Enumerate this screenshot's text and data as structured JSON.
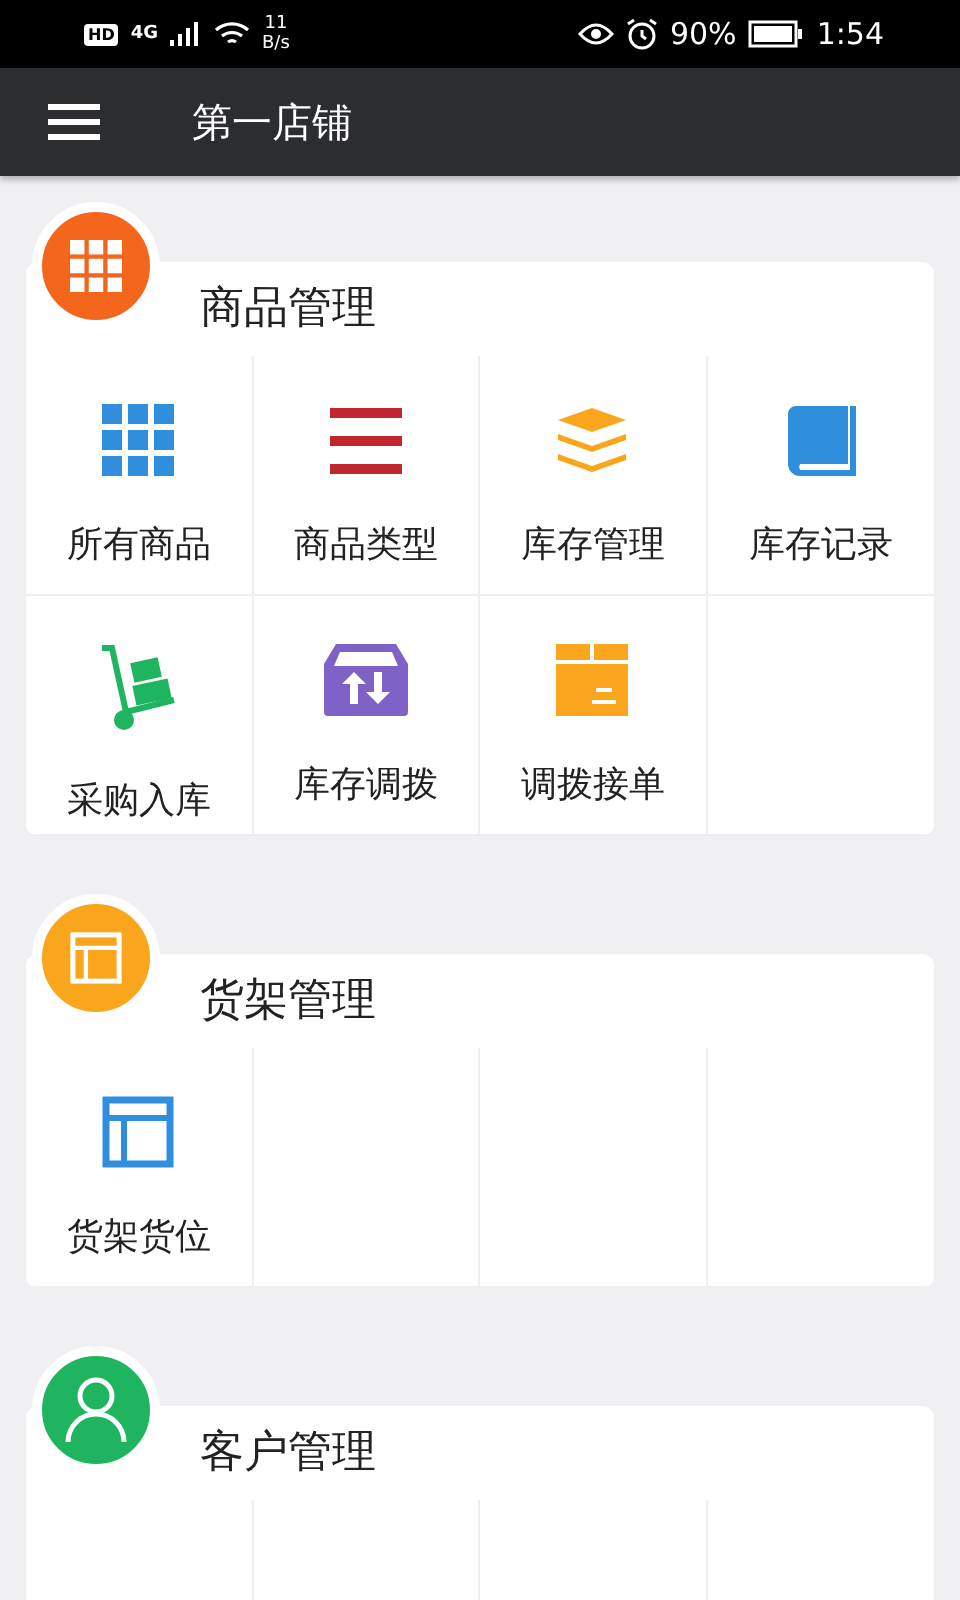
{
  "status_bar": {
    "hd": "HD",
    "network": "4G",
    "speed_value": "11",
    "speed_unit": "B/s",
    "battery": "90%",
    "time": "1:54"
  },
  "app_bar": {
    "title": "第一店铺"
  },
  "sections": [
    {
      "title": "商品管理",
      "kind": "grid",
      "color": "#f4661b",
      "items": [
        {
          "label": "所有商品",
          "kind": "grid"
        },
        {
          "label": "商品类型",
          "kind": "list"
        },
        {
          "label": "库存管理",
          "kind": "layers"
        },
        {
          "label": "库存记录",
          "kind": "book"
        },
        {
          "label": "采购入库",
          "kind": "cart"
        },
        {
          "label": "库存调拨",
          "kind": "transfer"
        },
        {
          "label": "调拨接单",
          "kind": "package"
        }
      ]
    },
    {
      "title": "货架管理",
      "kind": "shelf",
      "color": "#f9a61c",
      "items": [
        {
          "label": "货架货位",
          "kind": "shelf"
        }
      ]
    },
    {
      "title": "客户管理",
      "kind": "person",
      "color": "#1fb45f"
    }
  ]
}
